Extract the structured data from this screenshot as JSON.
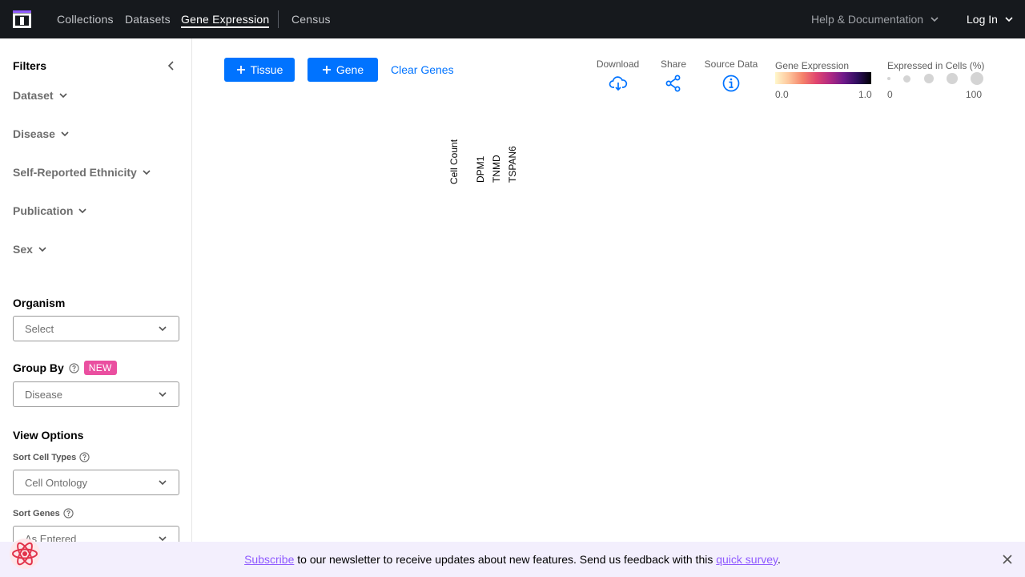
{
  "nav": {
    "links": [
      "Collections",
      "Datasets",
      "Gene Expression",
      "Census"
    ],
    "help_label": "Help & Documentation",
    "login_label": "Log In"
  },
  "sidebar": {
    "title": "Filters",
    "filters": [
      "Dataset",
      "Disease",
      "Self-Reported Ethnicity",
      "Publication",
      "Sex"
    ],
    "organism": {
      "title": "Organism",
      "value": "Select"
    },
    "group_by": {
      "title": "Group By",
      "badge": "NEW",
      "value": "Disease"
    },
    "view_options": {
      "title": "View Options",
      "sort_cell_types": {
        "label": "Sort Cell Types",
        "value": "Cell Ontology"
      },
      "sort_genes": {
        "label": "Sort Genes",
        "value": "As Entered"
      }
    }
  },
  "toolbar": {
    "tissue_label": "Tissue",
    "gene_label": "Gene",
    "clear_label": "Clear Genes",
    "download_label": "Download",
    "share_label": "Share",
    "source_label": "Source Data"
  },
  "legend": {
    "gene_expression_title": "Gene Expression",
    "gene_expression_min": "0.0",
    "gene_expression_max": "1.0",
    "expressed_title": "Expressed in Cells (%)",
    "expressed_min": "0",
    "expressed_max": "100"
  },
  "columns": [
    "Cell Count",
    "DPM1",
    "TNMD",
    "TSPAN6"
  ],
  "banner": {
    "subscribe_link": "Subscribe",
    "text": " to our newsletter to receive updates about new features. Send us feedback with this ",
    "survey_link": "quick survey",
    "end": "."
  },
  "colors": {
    "accent": "#0073ff",
    "nav_bg": "#16191d",
    "badge": "#ea4fa0",
    "banner_bg": "#f3effd",
    "link_purple": "#8f5aff"
  }
}
